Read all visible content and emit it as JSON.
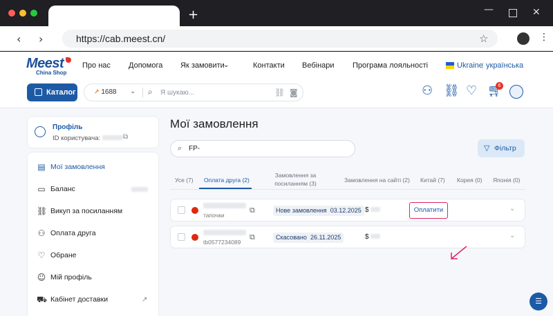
{
  "browser": {
    "url": "https://cab.meest.cn/",
    "new_tab": "+",
    "controls": {
      "minimize": "—",
      "close": "✕"
    }
  },
  "logo": {
    "brand": "Meest",
    "sub": "China Shop"
  },
  "nav": {
    "items": [
      "Про нас",
      "Допомога",
      "Як замовити",
      "Контакти",
      "Вебінари",
      "Програма лояльності"
    ],
    "country": "Ukraine",
    "language": "українська"
  },
  "header": {
    "catalog_label": "Каталог",
    "source": "1688",
    "search_placeholder": "Я шукаю...",
    "cart_count": "6"
  },
  "profile": {
    "title": "Профіль",
    "id_label": "ID користувача:"
  },
  "sidebar": {
    "items": [
      {
        "label": "Мої замовлення",
        "icon": "clipboard-icon",
        "active": true
      },
      {
        "label": "Баланс",
        "icon": "wallet-icon",
        "active": false
      },
      {
        "label": "Викуп за посиланням",
        "icon": "link-icon",
        "active": false
      },
      {
        "label": "Оплата друга",
        "icon": "users-icon",
        "active": false
      },
      {
        "label": "Обране",
        "icon": "heart-icon",
        "active": false
      },
      {
        "label": "Мій профіль",
        "icon": "user-icon",
        "active": false
      },
      {
        "label": "Кабінет доставки",
        "icon": "truck-icon",
        "active": false
      }
    ]
  },
  "main": {
    "title": "Мої замовлення",
    "search_value": "FP-",
    "filter_label": "Фільтр",
    "tabs": [
      {
        "label": "Усе (7)",
        "active": false
      },
      {
        "label": "Оплата друга (2)",
        "active": true
      },
      {
        "label": "Замовлення за посиланням (3)",
        "active": false
      },
      {
        "label": "Замовлення на сайті (2)",
        "active": false
      },
      {
        "label": "Китай (7)",
        "active": false
      },
      {
        "label": "Корея (0)",
        "active": false
      },
      {
        "label": "Японія (0)",
        "active": false
      }
    ],
    "orders": [
      {
        "subtitle": "тапочки",
        "status": "Нове замовлення",
        "date": "03.12.2025",
        "currency": "$",
        "pay_label": "Оплатити"
      },
      {
        "subtitle": "tb0577234089",
        "status": "Скасовано",
        "date": "26.11.2025",
        "currency": "$",
        "pay_label": ""
      }
    ]
  },
  "colors": {
    "brand": "#1c5aa6",
    "highlight": "#e0245e",
    "flag_cn": "#de2910"
  }
}
